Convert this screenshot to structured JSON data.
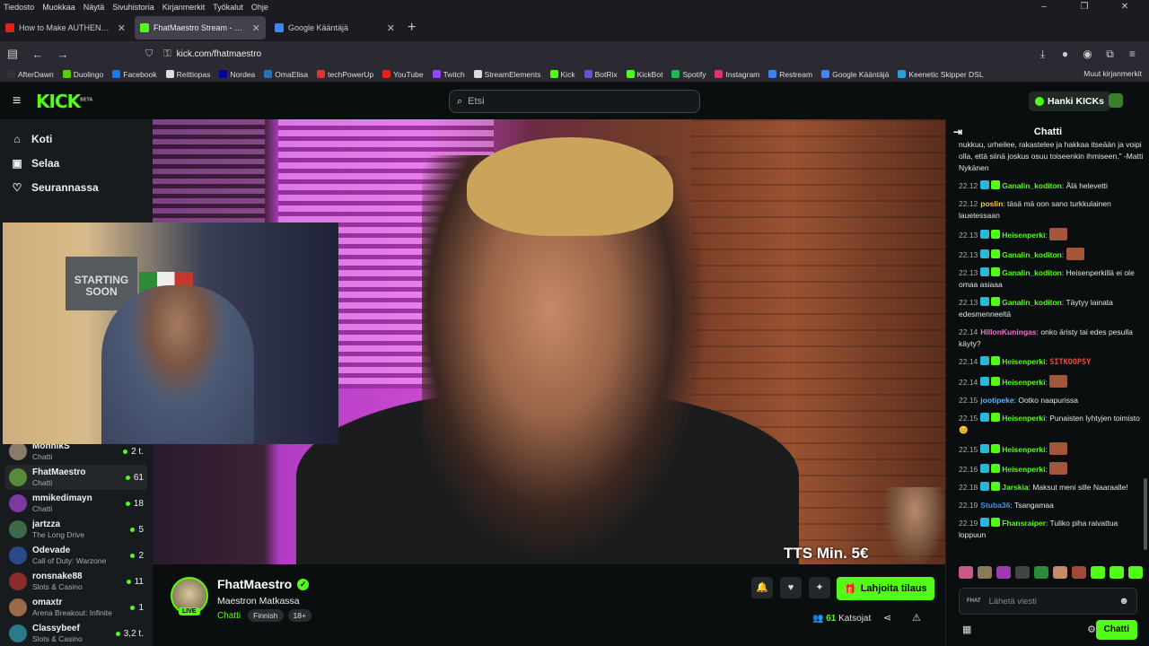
{
  "menubar": {
    "items": [
      "Tiedosto",
      "Muokkaa",
      "Näytä",
      "Sivuhistoria",
      "Kirjanmerkit",
      "Työkalut",
      "Ohje"
    ]
  },
  "tabs": [
    {
      "label": "How to Make AUTHENTIC BOLO",
      "color": "#e62117"
    },
    {
      "label": "FhatMaestro Stream - Watch",
      "color": "#53fc18"
    },
    {
      "label": "Google Kääntäjä",
      "color": "#4285f4"
    }
  ],
  "url": "kick.com/fhatmaestro",
  "bookmarks": [
    {
      "label": "AfterDawn",
      "color": "#333"
    },
    {
      "label": "Duolingo",
      "color": "#58cc02"
    },
    {
      "label": "Facebook",
      "color": "#1877f2"
    },
    {
      "label": "Reittiopas",
      "color": "#ddd"
    },
    {
      "label": "Nordea",
      "color": "#0000a0"
    },
    {
      "label": "OmaElisa",
      "color": "#2d6fb5"
    },
    {
      "label": "techPowerUp",
      "color": "#d33"
    },
    {
      "label": "YouTube",
      "color": "#e62117"
    },
    {
      "label": "Twitch",
      "color": "#9146ff"
    },
    {
      "label": "StreamElements",
      "color": "#ddd"
    },
    {
      "label": "Kick",
      "color": "#53fc18"
    },
    {
      "label": "BotRix",
      "color": "#6a4fd6"
    },
    {
      "label": "KickBot",
      "color": "#53fc18"
    },
    {
      "label": "Spotify",
      "color": "#1db954"
    },
    {
      "label": "Instagram",
      "color": "#e1306c"
    },
    {
      "label": "Restream",
      "color": "#3b82f6"
    },
    {
      "label": "Google Kääntäjä",
      "color": "#4285f4"
    },
    {
      "label": "Keenetic Skipper DSL",
      "color": "#2a9fd6"
    }
  ],
  "bookmarks_other": "Muut kirjanmerkit",
  "kick": {
    "logo": "KICK",
    "logo_sup": "BETA",
    "search_placeholder": "Etsi",
    "get_kicks": "Hanki KICKs",
    "nav": [
      {
        "label": "Koti",
        "icon": "home-icon"
      },
      {
        "label": "Selaa",
        "icon": "browse-icon"
      },
      {
        "label": "Seurannassa",
        "icon": "heart-icon"
      }
    ],
    "channels": [
      {
        "name": "MonhikS",
        "category": "Chatti",
        "viewers": "2 t.",
        "color": "#8a7a6a"
      },
      {
        "name": "FhatMaestro",
        "category": "Chatti",
        "viewers": "61",
        "color": "#5a8a3a"
      },
      {
        "name": "mmikedimayn",
        "category": "Chatti",
        "viewers": "18",
        "color": "#7a3aa0"
      },
      {
        "name": "jartzza",
        "category": "The Long Drive",
        "viewers": "5",
        "color": "#3a6a4a"
      },
      {
        "name": "Odevade",
        "category": "Call of Duty: Warzone",
        "viewers": "2",
        "color": "#2a4a8a"
      },
      {
        "name": "ronsnake88",
        "category": "Slots & Casino",
        "viewers": "11",
        "color": "#8a2a2a"
      },
      {
        "name": "omaxtr",
        "category": "Arena Breakout: Infinite",
        "viewers": "1",
        "color": "#9a6a4a"
      },
      {
        "name": "Classybeef",
        "category": "Slots & Casino",
        "viewers": "3,2 t.",
        "color": "#2a7a8a"
      }
    ],
    "webcam_poster": "STARTING SOON",
    "tts": "TTS Min. 5€",
    "streamer": {
      "name": "FhatMaestro",
      "live": "LIVE",
      "title": "Maestron Matkassa",
      "category": "Chatti",
      "tags": [
        "Finnish",
        "18+"
      ],
      "subscribe": "Lahjoita tilaus",
      "viewers": "61",
      "viewers_label": "Katsojat"
    },
    "chat": {
      "title": "Chatti",
      "messages": [
        {
          "time": "",
          "user": "",
          "text": "nukkuu, urheilee, rakastelee ja hakkaa itseään ja voipi olla, että siinä joskus osuu toiseenkin ihmiseen.\" -Matti Nykänen",
          "color": "#fff",
          "badges": false
        },
        {
          "time": "22.12",
          "user": "Ganalin_koditon",
          "text": "Älä helevetti",
          "color": "#53fc18",
          "badges": true
        },
        {
          "time": "22.12",
          "user": "poslin",
          "text": "täsä mä oon sano turkkulainen lauetessaan",
          "color": "#f2c94c",
          "badges": false
        },
        {
          "time": "22.13",
          "user": "Heisenperki",
          "text": "",
          "color": "#53fc18",
          "badges": true,
          "emote": true
        },
        {
          "time": "22.13",
          "user": "Ganalin_koditon",
          "text": "",
          "color": "#53fc18",
          "badges": true,
          "emote": true
        },
        {
          "time": "22.13",
          "user": "Ganalin_koditon",
          "text": "Heisenperkillä ei ole omaa asiaaa",
          "color": "#53fc18",
          "badges": true
        },
        {
          "time": "22.13",
          "user": "Ganalin_koditon",
          "text": "Täytyy lainata edesmenneeltä",
          "color": "#53fc18",
          "badges": true
        },
        {
          "time": "22.14",
          "user": "HillonKuningas",
          "text": "onko äristy tai edes pesulla käyty?",
          "color": "#ff6ad5",
          "badges": false
        },
        {
          "time": "22.14",
          "user": "Heisenperki",
          "text": "SITKOOPSY",
          "color": "#53fc18",
          "badges": true,
          "emote": true
        },
        {
          "time": "22.14",
          "user": "Heisenperki",
          "text": "",
          "color": "#53fc18",
          "badges": true,
          "emote": true
        },
        {
          "time": "22.15",
          "user": "jootipeke",
          "text": "Ootko naapurissa",
          "color": "#53b7fc",
          "badges": false
        },
        {
          "time": "22.15",
          "user": "Heisenperki",
          "text": "Punaisten lyhtyjen toimisto 😊",
          "color": "#53fc18",
          "badges": true
        },
        {
          "time": "22.15",
          "user": "Heisenperki",
          "text": "",
          "color": "#53fc18",
          "badges": true,
          "emote": true
        },
        {
          "time": "22.16",
          "user": "Heisenperki",
          "text": "",
          "color": "#53fc18",
          "badges": true,
          "emote": true
        },
        {
          "time": "22.18",
          "user": "Jarskia",
          "text": "Maksut meni sille Naaraalle!",
          "color": "#53fc18",
          "badges": true
        },
        {
          "time": "22.19",
          "user": "Stuba36",
          "text": "Tsangamaa",
          "color": "#4a90e2",
          "badges": false
        },
        {
          "time": "22.19",
          "user": "Fhansraiper",
          "text": "Tuliko piha raivattua loppuun",
          "color": "#53fc18",
          "badges": true
        }
      ],
      "input_placeholder": "Lähetä viesti",
      "send": "Chatti",
      "badge_text": "FHAT"
    }
  }
}
